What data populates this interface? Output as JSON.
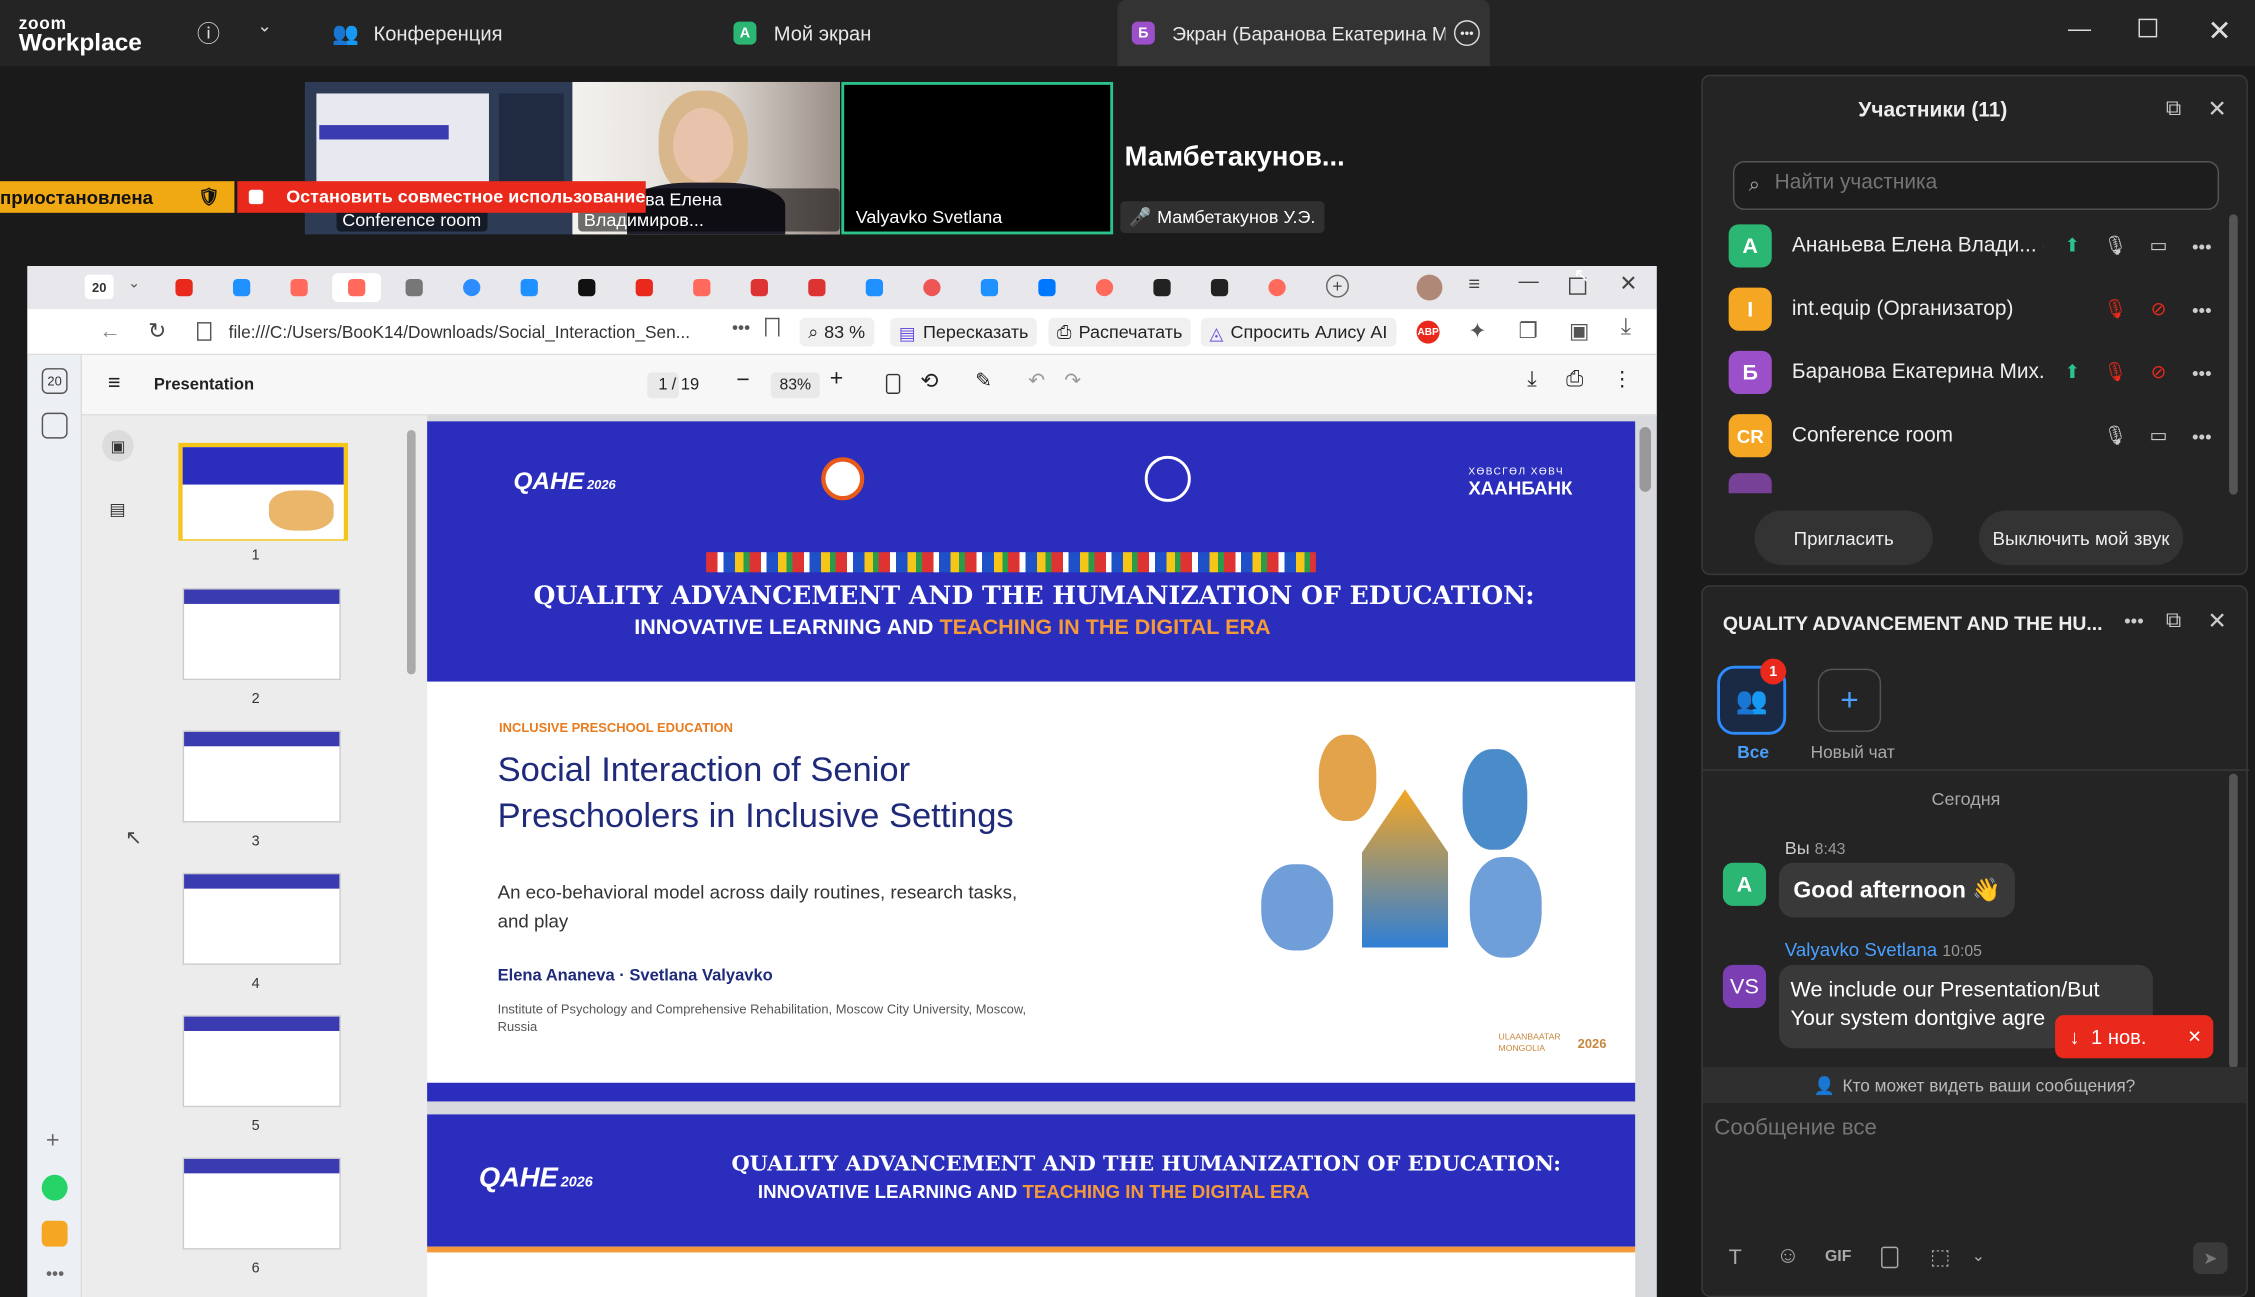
{
  "app": {
    "logo_line1": "zoom",
    "logo_line2": "Workplace"
  },
  "topbar": {
    "tabs": [
      {
        "label": "Конференция",
        "badge": ""
      },
      {
        "label": "Мой экран",
        "badge": "A",
        "badge_color": "#2bb673"
      },
      {
        "label": "Экран (Баранова Екатерина Ми:",
        "badge": "Б",
        "badge_color": "#9b4fc9"
      }
    ],
    "icons": [
      "info-icon",
      "chevron-down-icon",
      "more-icon",
      "minimize-icon",
      "maximize-icon",
      "close-icon"
    ]
  },
  "videos": {
    "tiles": [
      {
        "name": "Conference room"
      },
      {
        "name": "Ананьева Елена Владимиров..."
      },
      {
        "name": "Valyavko Svetlana"
      }
    ],
    "speaker_title": "Мамбетакунов...",
    "speaker_sub": "Мамбетакунов У.Э."
  },
  "banners": {
    "paused": "приостановлена",
    "stop": "Остановить совместное использование"
  },
  "browser": {
    "tab_count_badge": "20",
    "address": "file:///C:/Users/BooK14/Downloads/Social_Interaction_Sen...",
    "zoom": "83 %",
    "btn_retell": "Пересказать",
    "btn_print": "Распечатать",
    "btn_alisa": "Спросить Алису AI",
    "pdf_title": "Presentation",
    "page_current": "1",
    "page_total": "/ 19",
    "pdf_zoom": "83%",
    "rail_badge": "20"
  },
  "thumbs": [
    "1",
    "2",
    "3",
    "4",
    "5",
    "6"
  ],
  "slide": {
    "logo_left": "QAHE",
    "logo_left_sub": "2026",
    "bank_small": "ХӨВСГӨЛ ХӨВЧ",
    "bank": "ХААНБАНК",
    "headline1": "QUALITY ADVANCEMENT AND THE HUMANIZATION OF EDUCATION:",
    "headline2a": "INNOVATIVE LEARNING AND",
    "headline2b": "TEACHING IN THE DIGITAL ERA",
    "kicker": "INCLUSIVE PRESCHOOL EDUCATION",
    "title1": "Social Interaction of Senior",
    "title2": "Preschoolers in Inclusive Settings",
    "subtitle1": "An eco-behavioral model across daily routines, research tasks,",
    "subtitle2": "and play",
    "authors": "Elena Ananeva · Svetlana Valyavko",
    "affil1": "Institute of Psychology and Comprehensive Rehabilitation, Moscow City University, Moscow,",
    "affil2": "Russia",
    "city": "ULAANBAATAR MONGOLIA",
    "year": "2026"
  },
  "participants": {
    "title": "Участники (11)",
    "search_placeholder": "Найти участника",
    "rows": [
      {
        "initial": "А",
        "color": "#2bb673",
        "name": "Ананьева Елена Влади... (Я)"
      },
      {
        "initial": "I",
        "color": "#f5a623",
        "name": "int.equip (Организатор)"
      },
      {
        "initial": "Б",
        "color": "#9b4fc9",
        "name": "Баранова Екатерина Мих..."
      },
      {
        "initial": "CR",
        "color": "#f5a623",
        "name": "Conference room"
      }
    ],
    "invite": "Пригласить",
    "mute_me": "Выключить мой звук"
  },
  "chat": {
    "title": "QUALITY ADVANCEMENT AND THE HU...",
    "all_label": "Все",
    "all_badge": "1",
    "new_chat": "Новый чат",
    "today": "Сегодня",
    "msg1_sender": "Вы",
    "msg1_time": "8:43",
    "msg1_text": "Good afternoon 👋",
    "msg2_initials": "VS",
    "msg2_sender": "Valyavko Svetlana",
    "msg2_time": "10:05",
    "msg2_line1": "We  include our  Presentation/But",
    "msg2_line2": "Your system dontgive agre",
    "new_toast": "1 нов.",
    "who_sees": "Кто может видеть ваши сообщения?",
    "input_placeholder": "Сообщение все",
    "gif": "GIF"
  }
}
